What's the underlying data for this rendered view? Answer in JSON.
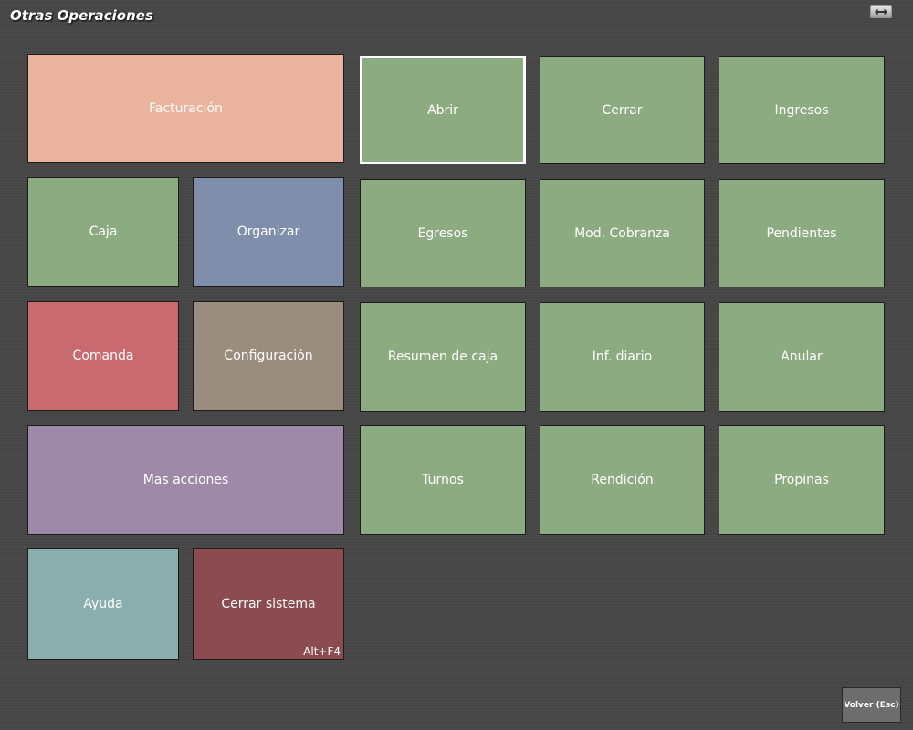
{
  "window": {
    "title": "Otras Operaciones",
    "resize_icon": "double-arrow-icon"
  },
  "tiles": [
    {
      "label": "Facturación",
      "color": "#eab39d"
    },
    {
      "label": "Caja",
      "color": "#8cab81"
    },
    {
      "label": "Organizar",
      "color": "#7e8eab"
    },
    {
      "label": "Comanda",
      "color": "#c96a70"
    },
    {
      "label": "Configuración",
      "color": "#9a8d7e"
    },
    {
      "label": "Mas acciones",
      "color": "#9e89a9"
    },
    {
      "label": "Ayuda",
      "color": "#8aadae"
    },
    {
      "label": "Cerrar sistema",
      "shortcut": "Alt+F4",
      "color": "#8b4b50"
    },
    {
      "label": "Abrir",
      "color": "#8cab81",
      "selected": true
    },
    {
      "label": "Cerrar",
      "color": "#8cab81"
    },
    {
      "label": "Ingresos",
      "color": "#8cab81"
    },
    {
      "label": "Egresos",
      "color": "#8cab81"
    },
    {
      "label": "Mod. Cobranza",
      "color": "#8cab81"
    },
    {
      "label": "Pendientes",
      "color": "#8cab81"
    },
    {
      "label": "Resumen de caja",
      "color": "#8cab81"
    },
    {
      "label": "Inf. diario",
      "color": "#8cab81"
    },
    {
      "label": "Anular",
      "color": "#8cab81"
    },
    {
      "label": "Turnos",
      "color": "#8cab81"
    },
    {
      "label": "Rendición",
      "color": "#8cab81"
    },
    {
      "label": "Propinas",
      "color": "#8cab81"
    }
  ],
  "footer": {
    "back_label": "Volver (Esc)"
  }
}
